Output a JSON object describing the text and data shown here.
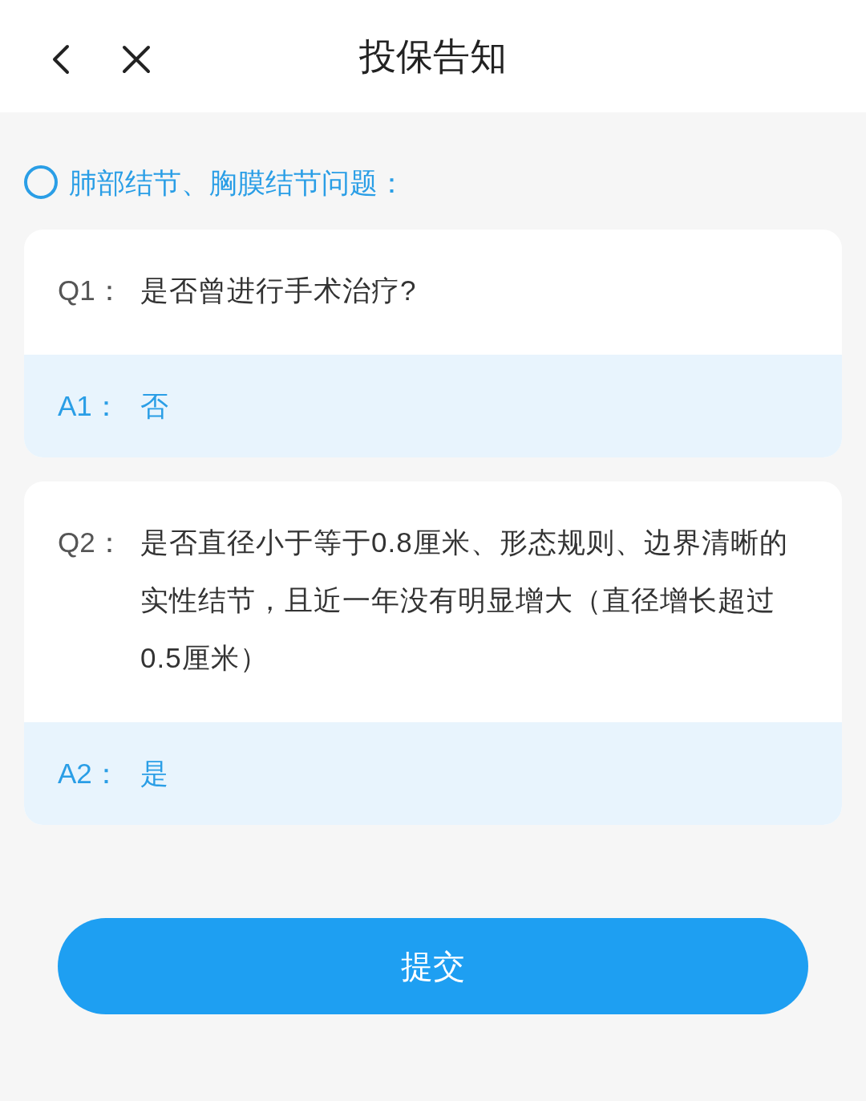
{
  "header": {
    "title": "投保告知"
  },
  "section": {
    "title": "肺部结节、胸膜结节问题："
  },
  "items": [
    {
      "q_label": "Q1：",
      "question": "是否曾进行手术治疗?",
      "a_label": "A1：",
      "answer": "否"
    },
    {
      "q_label": "Q2：",
      "question": "是否直径小于等于0.8厘米、形态规则、边界清晰的实性结节，且近一年没有明显增大（直径增长超过0.5厘米）",
      "a_label": "A2：",
      "answer": "是"
    }
  ],
  "submit": {
    "label": "提交"
  }
}
